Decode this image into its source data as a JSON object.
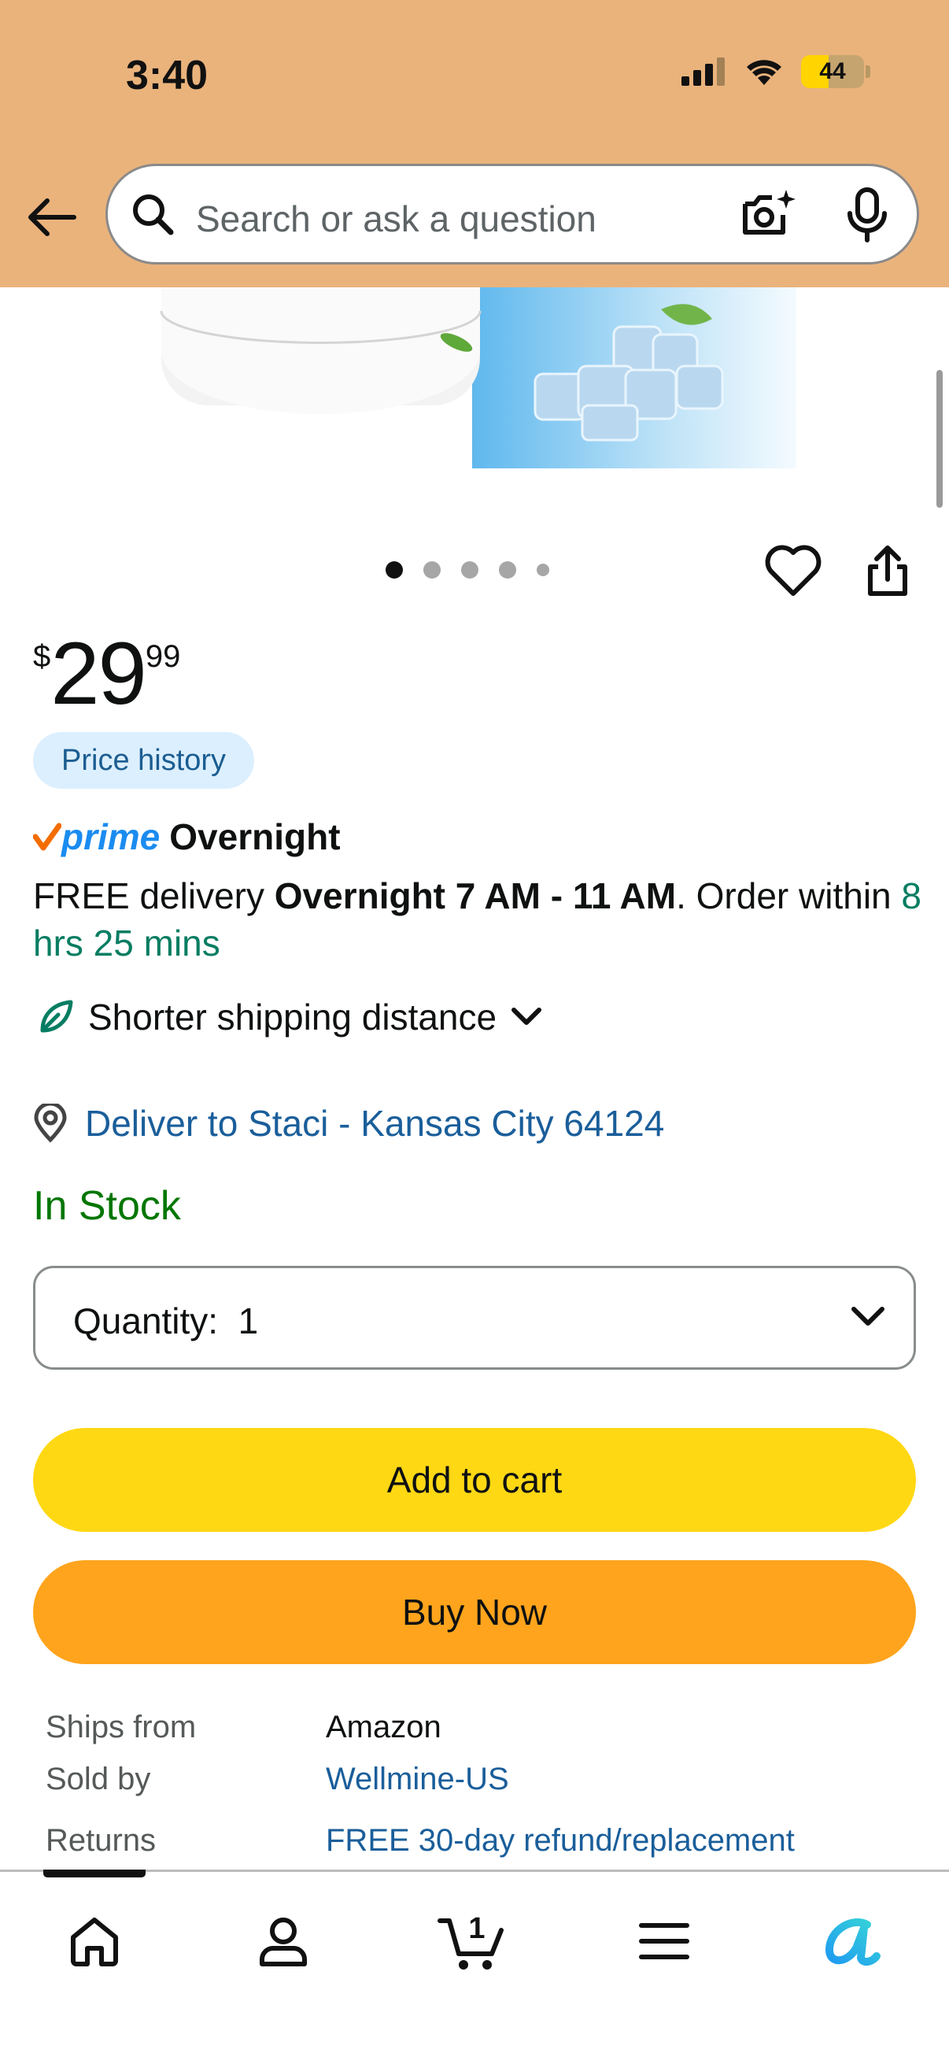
{
  "status_bar": {
    "time": "3:40",
    "battery_level": "44",
    "battery_fraction": 0.44
  },
  "search": {
    "placeholder": "Search or ask a question"
  },
  "carousel": {
    "total": 5,
    "active_index": 0
  },
  "price": {
    "currency": "$",
    "whole": "29",
    "fraction": "99"
  },
  "price_history_label": "Price history",
  "prime": {
    "brand": "prime",
    "speed": "Overnight"
  },
  "delivery": {
    "prefix": "FREE delivery ",
    "window": "Overnight 7 AM - 11 AM",
    "mid": ". Order within ",
    "countdown": "8 hrs 25 mins"
  },
  "shipping_note": "Shorter shipping distance",
  "deliver_to": "Deliver to Staci - Kansas City 64124",
  "stock_status": "In Stock",
  "quantity": {
    "label": "Quantity:",
    "value": "1"
  },
  "buttons": {
    "add_to_cart": "Add to cart",
    "buy_now": "Buy Now"
  },
  "details": [
    {
      "key": "Ships from",
      "value": "Amazon",
      "link": false
    },
    {
      "key": "Sold by",
      "value": "Wellmine-US",
      "link": true
    },
    {
      "key": "Returns",
      "value": "FREE 30-day refund/replacement",
      "link": true
    }
  ],
  "tabbar": {
    "tabs": [
      "home-icon",
      "account-icon",
      "cart-icon",
      "menu-icon",
      "rufus-icon"
    ],
    "cart_count": "1"
  },
  "colors": {
    "header_bg": "#eab37c",
    "add_to_cart": "#ffd814",
    "buy_now": "#ffa41c",
    "link": "#1a5e9a",
    "in_stock": "#007600",
    "countdown": "#067d62"
  }
}
